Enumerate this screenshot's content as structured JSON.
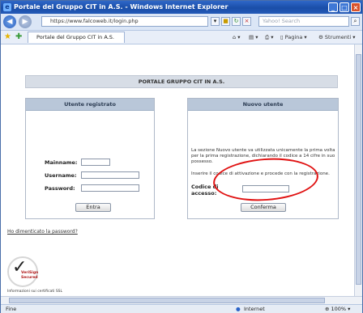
{
  "window": {
    "title": "Portale del Gruppo CIT in A.S. - Windows Internet Explorer"
  },
  "address": {
    "url": "https://www.falcoweb.it/login.php",
    "search_placeholder": "Yahoo! Search"
  },
  "tab": {
    "label": "Portale del Gruppo CIT in A.S."
  },
  "commands": {
    "page": "Pagina",
    "tools": "Strumenti"
  },
  "page": {
    "banner": "PORTALE GRUPPO CIT IN A.S.",
    "left": {
      "title": "Utente registrato",
      "fields": [
        "Mainname:",
        "Username:",
        "Password:"
      ],
      "submit": "Entra",
      "forgot": "Ho dimenticato la password?"
    },
    "right": {
      "title": "Nuovo utente",
      "intro": "La sezione Nuovo utente va utilizzata unicamente la prima volta per la prima registrazione, dichiarando il codice a 14 cifre in suo possesso.",
      "instruction": "Inserire il codice di attivazione e procede con la registrazione.",
      "code_label_1": "Codice di",
      "code_label_2": "accesso:",
      "submit": "Conferma"
    },
    "badge": {
      "line1": "VeriSign",
      "line2": "Secured"
    },
    "badge_caption": "Informazioni sui certificati SSL"
  },
  "status": {
    "left": "Fine",
    "zone": "Internet",
    "zoom": "100%"
  },
  "colors": {
    "titlebar": "#1a4ea8",
    "panel_header": "#b9c7d9",
    "highlight": "#e01212"
  }
}
